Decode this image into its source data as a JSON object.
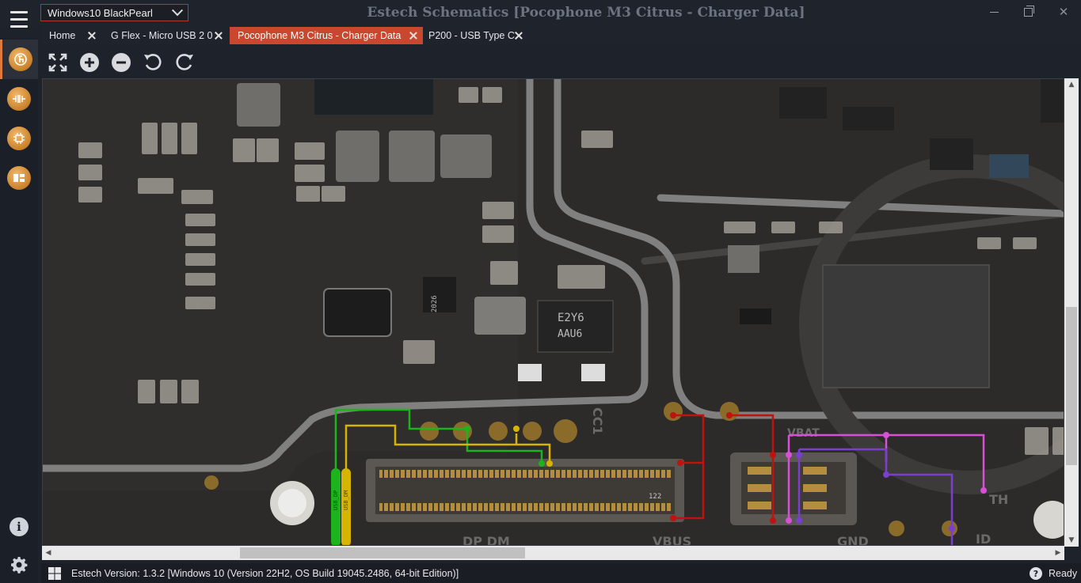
{
  "window": {
    "title": "Estech Schematics [Pocophone M3 Citrus - Charger Data]",
    "theme_selected": "Windows10 BlackPearl"
  },
  "left_nav": {
    "items": [
      {
        "icon": "logo-g-icon",
        "active": true
      },
      {
        "icon": "component-icon",
        "active": false
      },
      {
        "icon": "circuit-icon",
        "active": false
      },
      {
        "icon": "board-layout-icon",
        "active": false
      }
    ],
    "bottom": [
      {
        "icon": "info-icon"
      },
      {
        "icon": "gear-icon"
      }
    ]
  },
  "tabs": [
    {
      "label": "Home",
      "active": false
    },
    {
      "label": "G Flex - Micro USB 2 0",
      "active": false
    },
    {
      "label": "Pocophone M3 Citrus - Charger Data",
      "active": true
    },
    {
      "label": "P200 - USB Type C",
      "active": false
    }
  ],
  "toolbar": {
    "tools": [
      "fit-screen-icon",
      "zoom-in-icon",
      "zoom-out-icon",
      "rotate-left-icon",
      "rotate-right-icon"
    ]
  },
  "board": {
    "labels": {
      "vbat": "VBAT",
      "vbus": "VBUS",
      "gnd": "GND",
      "cc1": "CC1",
      "dp_dm": "DP DM",
      "th": "TH",
      "id": "ID",
      "chip_e2": "E2Y6",
      "chip_e2b": "AAU6",
      "chip_a": "2026",
      "connector_num": "122",
      "usb_dp": "USB_DP",
      "usb_dm": "USB_DM"
    },
    "trace_colors": {
      "green": "#1db31d",
      "yellow": "#d6b400",
      "red": "#c0120f",
      "magenta": "#d84fd8",
      "purple": "#7b3fd0"
    }
  },
  "status": {
    "version": "Estech Version: 1.3.2 [Windows 10 (Version 22H2, OS Build 19045.2486, 64-bit Edition)]",
    "state": "Ready"
  }
}
